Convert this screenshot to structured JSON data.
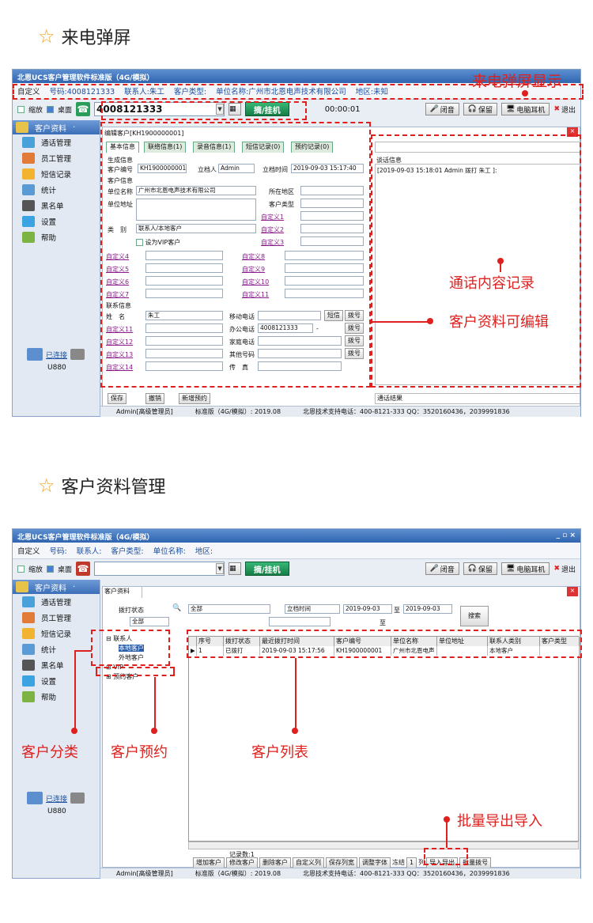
{
  "section1": {
    "title": "来电弹屏"
  },
  "section2": {
    "title": "客户资料管理"
  },
  "app": {
    "title": "北恩UCS客户管理软件标准版（4G/模拟）",
    "info1": {
      "custom": "自定义",
      "phone": "号码:4008121333",
      "contact": "联系人:朱工",
      "ctype": "客户类型:",
      "company": "单位名称:广州市北恩电声技术有限公司",
      "area": "地区:未知"
    },
    "info2": {
      "custom": "自定义",
      "phone": "号码:",
      "contact": "联系人:",
      "ctype": "客户类型:",
      "company": "单位名称:",
      "area": "地区:"
    },
    "toolbar": {
      "shrink": "缩放",
      "desktop": "桌面",
      "number": "4008121333",
      "dial": "摘/挂机",
      "timer": "00:00:01",
      "mute": "闭音",
      "hold": "保留",
      "pc_headset": "电脑耳机",
      "exit": "退出"
    },
    "sidebar": {
      "head": "客户资料",
      "items": [
        "通话管理",
        "员工管理",
        "短信记录",
        "统计",
        "黑名单",
        "设置",
        "帮助"
      ],
      "connected": "已连接",
      "device": "U880"
    },
    "status": {
      "user": "Admin[高级管理员]",
      "version": "标准版（4G/模拟）: 2019.08",
      "support": "北恩技术支持电话：400-8121-333  QQ：3520160436，2039991836"
    }
  },
  "edit": {
    "header": "编辑客户[KH1900000001]",
    "tabs": [
      "基本信息",
      "联络信息(1)",
      "录音信息(1)",
      "短信记录(0)",
      "预约记录(0)"
    ],
    "gen_title": "生成信息",
    "cust_no_label": "客户编号",
    "cust_no": "KH1900000001",
    "creator_label": "立档人",
    "creator": "Admin",
    "time_label": "立档时间",
    "time": "2019-09-03 15:17:40",
    "cust_info": "客户信息",
    "company_label": "单位名称",
    "company": "广州市北恩电声技术有限公司",
    "region_label": "所在地区",
    "addr_label": "单位地址",
    "ctype_label": "客户类型",
    "class_label": "类　别",
    "class": "联系人/本地客户",
    "vip": "设为VIP客户",
    "custom": [
      "自定义1",
      "自定义2",
      "自定义3",
      "自定义4",
      "自定义5",
      "自定义6",
      "自定义7",
      "自定义8",
      "自定义9",
      "自定义10",
      "自定义11",
      "自定义11",
      "自定义12",
      "自定义13",
      "自定义14"
    ],
    "contact_title": "联系信息",
    "name_label": "姓　名",
    "name": "朱工",
    "mobile_label": "移动电话",
    "sms": "短信",
    "dial": "拨号",
    "office_label": "办公电话",
    "office": "4008121333",
    "dash": "-",
    "home_label": "家庭电话",
    "other_label": "其他号码",
    "fax_label": "传　真",
    "buttons": {
      "save": "保存",
      "cancel": "撤销",
      "new_appt": "新增预约"
    },
    "talk_title": "谈话信息",
    "talk_record": "[2019-09-03 15:18:01 Admin 拨打 朱工 ]:",
    "talk_result": "通话结果"
  },
  "annotations": {
    "popup": "来电弹屏显示",
    "talk": "通话内容记录",
    "editable": "客户资料可编辑",
    "category": "客户分类",
    "appointment": "客户预约",
    "list": "客户列表",
    "export": "批量导出导入"
  },
  "mgmt": {
    "tab": "客户资料",
    "dial_status_label": "拨打状态",
    "all1": "全部",
    "all2": "全部",
    "date_field": "立档时间",
    "date_from": "2019-09-03",
    "to1": "至",
    "date_to": "2019-09-03",
    "to2": "至",
    "search": "搜索",
    "tree": {
      "contacts": "联系人",
      "local": "本地客户",
      "outside": "外地客户",
      "vip": "VIP",
      "appt": "预约客户"
    },
    "columns": [
      "序号",
      "拨打状态",
      "最近拨打时间",
      "客户编号",
      "单位名称",
      "单位地址",
      "联系人类别",
      "客户类型"
    ],
    "rows": [
      [
        "1",
        "已拨打",
        "2019-09-03 15:17:56",
        "KH1900000001",
        "广州市北恩电声",
        "",
        "本地客户",
        ""
      ]
    ],
    "record_count": "记录数:1",
    "bottom": [
      "增加客户",
      "修改客户",
      "删除客户",
      "自定义列",
      "保存列宽",
      "调整字体",
      "冻结",
      "1",
      "列",
      "导入导出",
      "批量拨号"
    ]
  }
}
